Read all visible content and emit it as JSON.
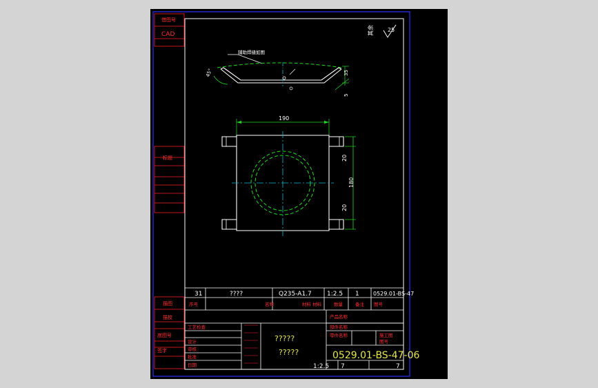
{
  "drawing": {
    "left_column": {
      "top_box_1": "借图号",
      "top_box_2": "CAD",
      "mid_label": "标题",
      "lower_1": "描图",
      "lower_2": "描校",
      "lower_3": "底图号",
      "lower_4": "签字"
    },
    "roughness": {
      "label": "其余",
      "value": "25"
    },
    "weld_note": "辅助焊缝如图",
    "dims": {
      "angle": "45°",
      "height_top": "35",
      "height_small": "5",
      "width": "190",
      "side_20a": "20",
      "height": "180",
      "side_20b": "20"
    },
    "parts_row": {
      "index": "31",
      "name": "????",
      "material": "Q235-A1.7",
      "scale": "1:2.5",
      "qty": "1",
      "drawing_no": "0529.01-BS-47"
    },
    "parts_header": {
      "col1": "序号",
      "col2": "名称",
      "col3": "材料 材料",
      "col4": "数量",
      "col5": "备注",
      "col6": "图号"
    },
    "title_block": {
      "rows_left": [
        "工艺检查",
        "设计",
        "审核",
        "批准",
        "日期"
      ],
      "center_title_1": "?????",
      "center_title_2": "?????",
      "right_label_1": "产品名称",
      "right_label_2": "部件名称",
      "right_label_3": "零件名称",
      "right_col_a": "施工图",
      "right_col_b": "图号",
      "code": "0529.01-BS-47-06",
      "scale": "1:2.5",
      "sheet_a": "7",
      "sheet_b": "7"
    }
  },
  "colors": {
    "background_outer": "#d4d4d4",
    "sheet": "#000000",
    "border_blue": "#2a2aff",
    "line_white": "#ffffff",
    "line_red": "#ff2020",
    "line_green": "#22dd22",
    "line_cyan": "#00bcd4",
    "text_yellow": "#e8e850",
    "text_red": "#ff3030"
  }
}
